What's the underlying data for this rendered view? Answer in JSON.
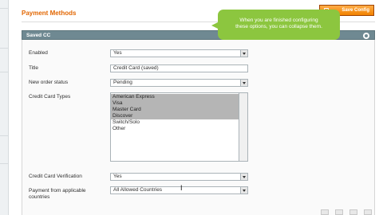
{
  "header": {
    "title": "Payment Methods",
    "save_button_label": "Save Config"
  },
  "tooltip": {
    "line1": "When you are finished configuring",
    "line2": "these options, you can collapse them."
  },
  "fieldset": {
    "title": "Saved CC"
  },
  "fields": {
    "enabled": {
      "label": "Enabled",
      "value": "Yes"
    },
    "title": {
      "label": "Title",
      "value": "Credit Card (saved)"
    },
    "new_order_status": {
      "label": "New order status",
      "value": "Pending"
    },
    "cc_types": {
      "label": "Credit Card Types",
      "options": [
        {
          "label": "American Express",
          "selected": true
        },
        {
          "label": "Visa",
          "selected": true
        },
        {
          "label": "Master Card",
          "selected": true
        },
        {
          "label": "Discover",
          "selected": true
        },
        {
          "label": "Switch/Solo",
          "selected": false
        },
        {
          "label": "Other",
          "selected": false
        }
      ]
    },
    "cc_verification": {
      "label": "Credit Card Verification",
      "value": "Yes"
    },
    "applicable_countries": {
      "label_line1": "Payment from applicable",
      "label_line2": "countries",
      "value": "All Allowed Countries"
    }
  }
}
